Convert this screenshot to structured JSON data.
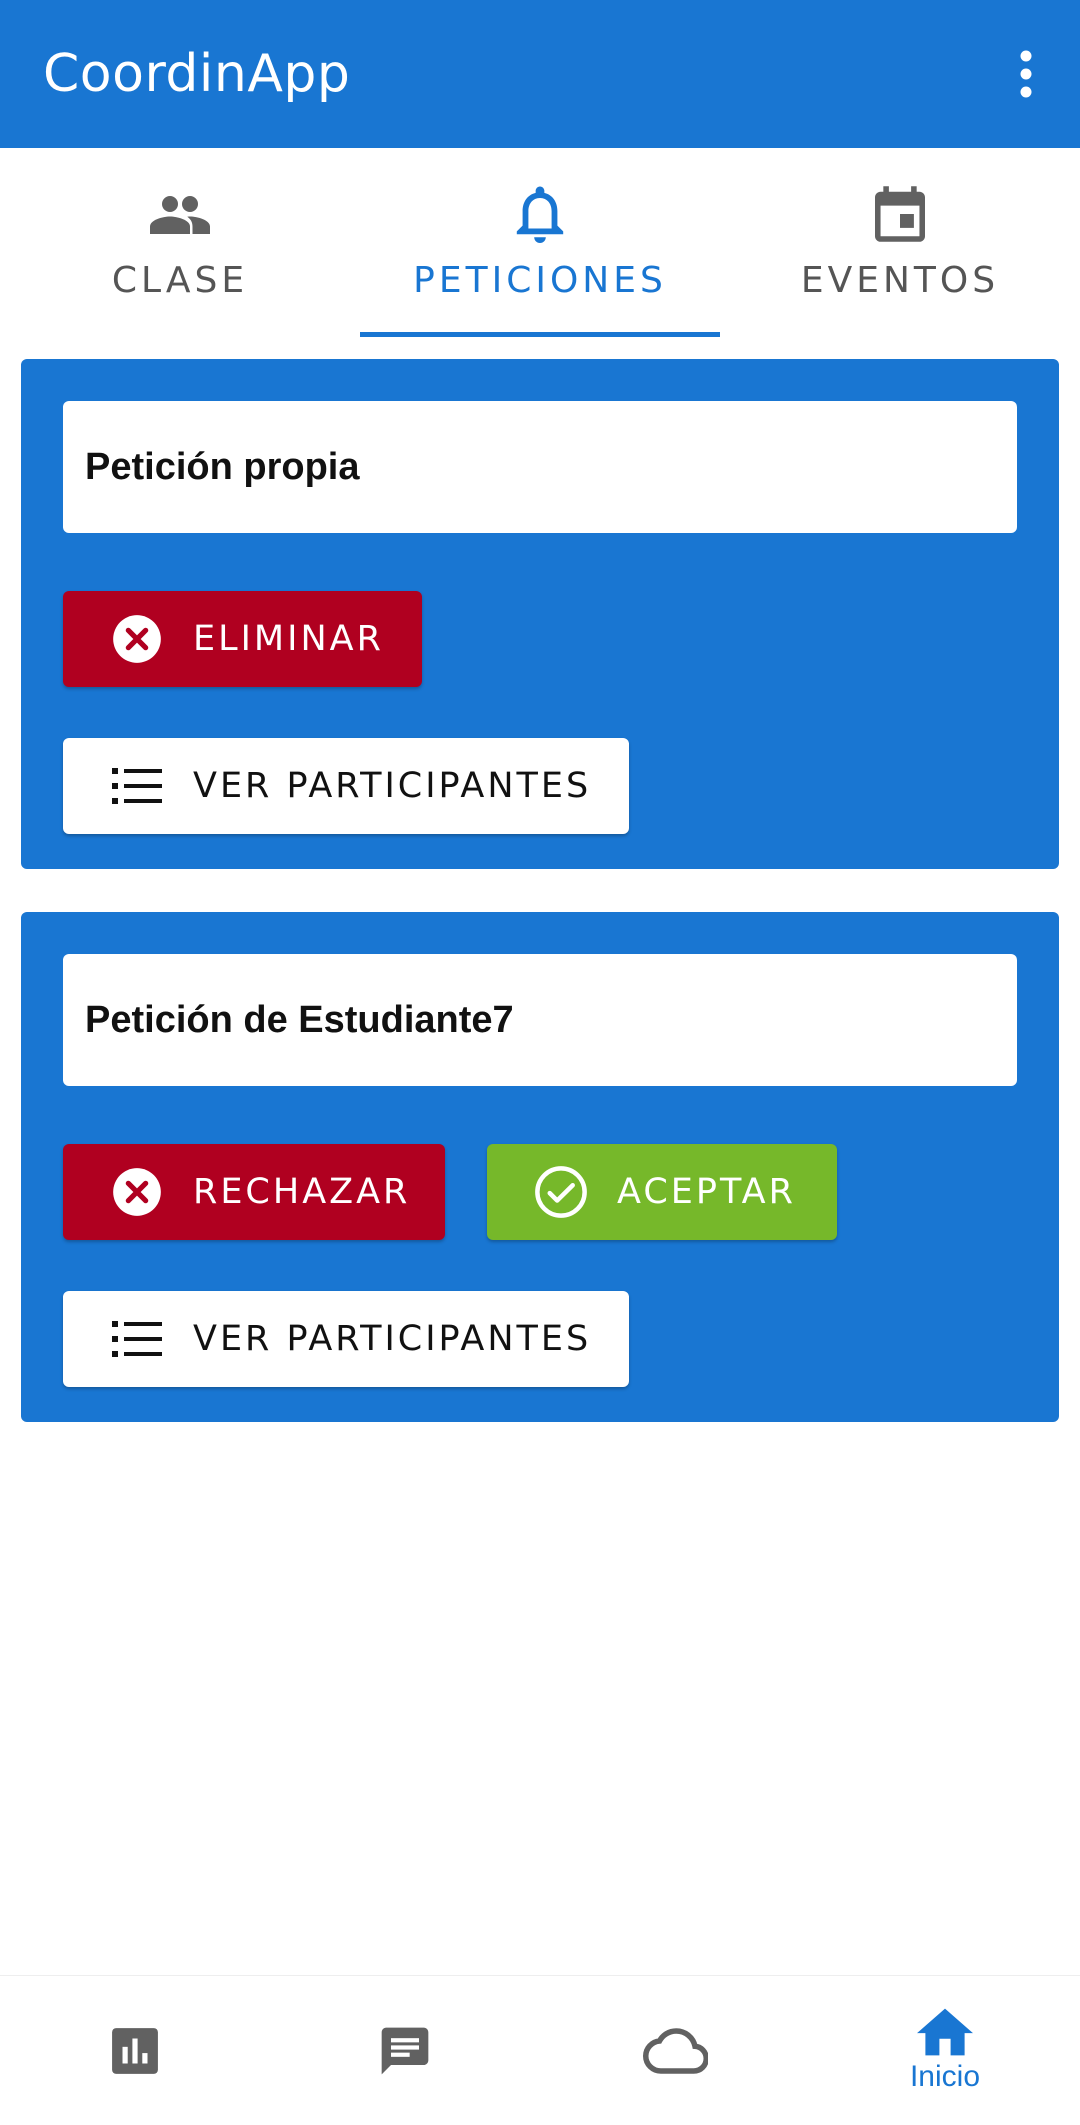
{
  "app": {
    "title": "CoordinApp",
    "menu_icon": "more-vert-icon"
  },
  "colors": {
    "primary": "#1976d2",
    "danger": "#b00020",
    "success": "#76b82a"
  },
  "tabs": [
    {
      "label": "CLASE",
      "icon": "group-icon",
      "active": false
    },
    {
      "label": "PETICIONES",
      "icon": "bell-icon",
      "active": true
    },
    {
      "label": "EVENTOS",
      "icon": "calendar-icon",
      "active": false
    }
  ],
  "requests": [
    {
      "title": "Petición propia",
      "delete_label": "ELIMINAR",
      "participants_label": "VER PARTICIPANTES"
    },
    {
      "title": "Petición de Estudiante7",
      "reject_label": "RECHAZAR",
      "accept_label": "ACEPTAR",
      "participants_label": "VER PARTICIPANTES"
    }
  ],
  "bottom_nav": [
    {
      "icon": "bar-chart-icon",
      "label": ""
    },
    {
      "icon": "chat-icon",
      "label": ""
    },
    {
      "icon": "cloud-icon",
      "label": ""
    },
    {
      "icon": "home-icon",
      "label": "Inicio",
      "active": true
    }
  ]
}
